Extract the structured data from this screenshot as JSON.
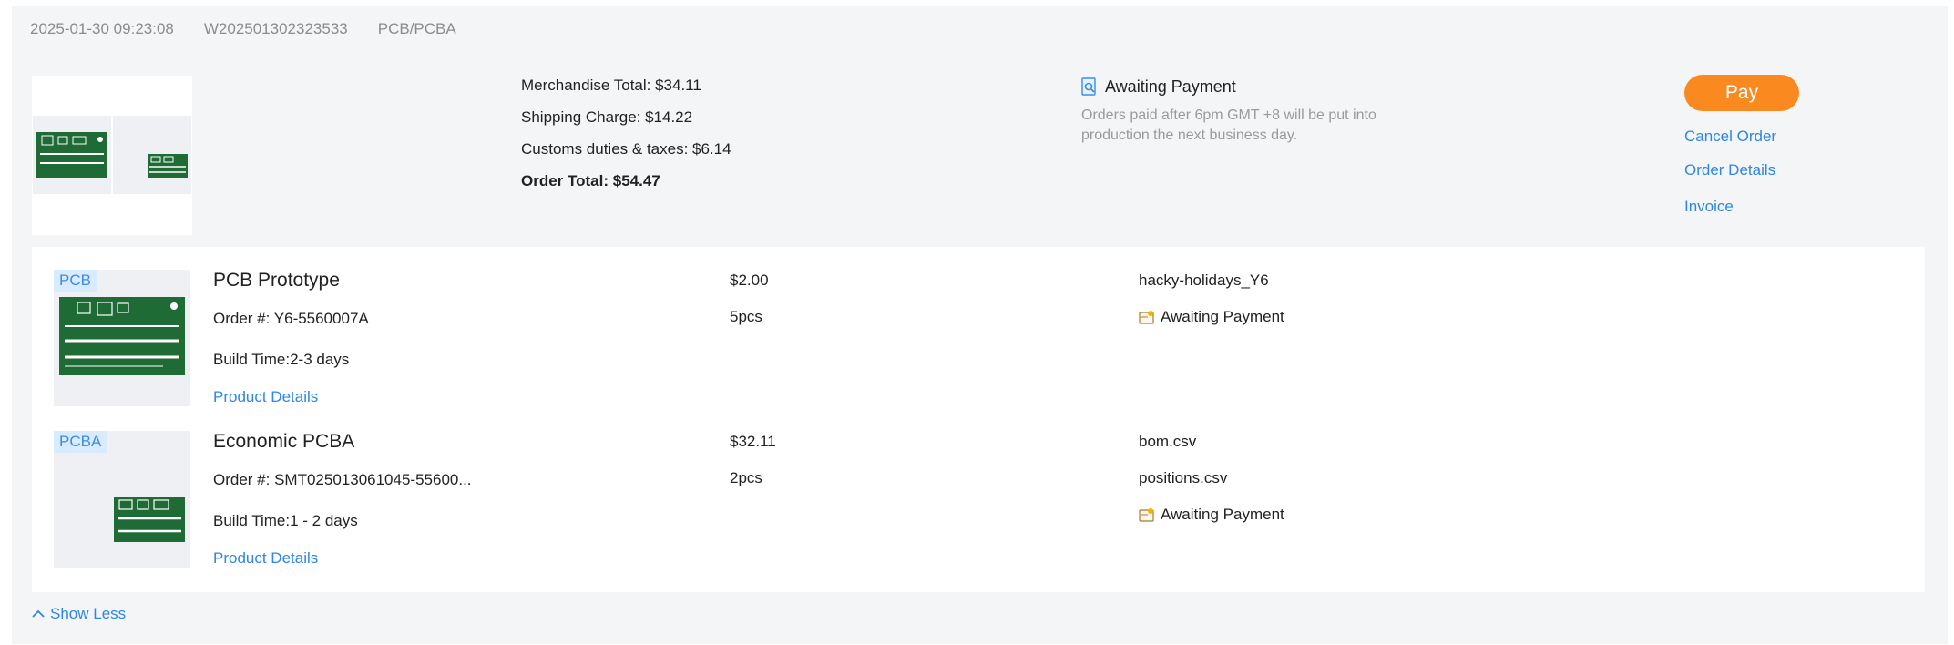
{
  "order": {
    "date": "2025-01-30 09:23:08",
    "number": "W202501302323533",
    "type": "PCB/PCBA"
  },
  "summary": {
    "merchandise": "Merchandise Total: $34.11",
    "shipping": "Shipping Charge: $14.22",
    "customs": "Customs duties & taxes: $6.14",
    "total": "Order Total: $54.47"
  },
  "status": {
    "label": "Awaiting Payment",
    "icon": "search-document-icon",
    "note": "Orders paid after 6pm GMT +8 will be put into production the next business day."
  },
  "actions": {
    "pay": "Pay",
    "cancel": "Cancel Order",
    "details": "Order Details",
    "invoice": "Invoice"
  },
  "items": [
    {
      "tag": "PCB",
      "name": "PCB Prototype",
      "order_no": "Order #: Y6-5560007A",
      "build_time": "Build Time:2-3 days",
      "link": "Product Details",
      "price": "$2.00",
      "quantity": "5pcs",
      "files": [
        "hacky-holidays_Y6"
      ],
      "status": "Awaiting Payment",
      "status_icon": "wallet-icon"
    },
    {
      "tag": "PCBA",
      "name": "Economic PCBA",
      "order_no": "Order #: SMT025013061045-55600...",
      "build_time": "Build Time:1 - 2 days",
      "link": "Product Details",
      "price": "$32.11",
      "quantity": "2pcs",
      "files": [
        "bom.csv",
        "positions.csv"
      ],
      "status": "Awaiting Payment",
      "status_icon": "wallet-icon"
    }
  ],
  "footer": {
    "toggle": "Show Less",
    "toggle_icon": "chevron-up-icon"
  },
  "colors": {
    "accent": "#fa8a1f",
    "link": "#2f86e6",
    "pcb_green": "#1e6b35",
    "tag_bg": "#d9ebff"
  }
}
